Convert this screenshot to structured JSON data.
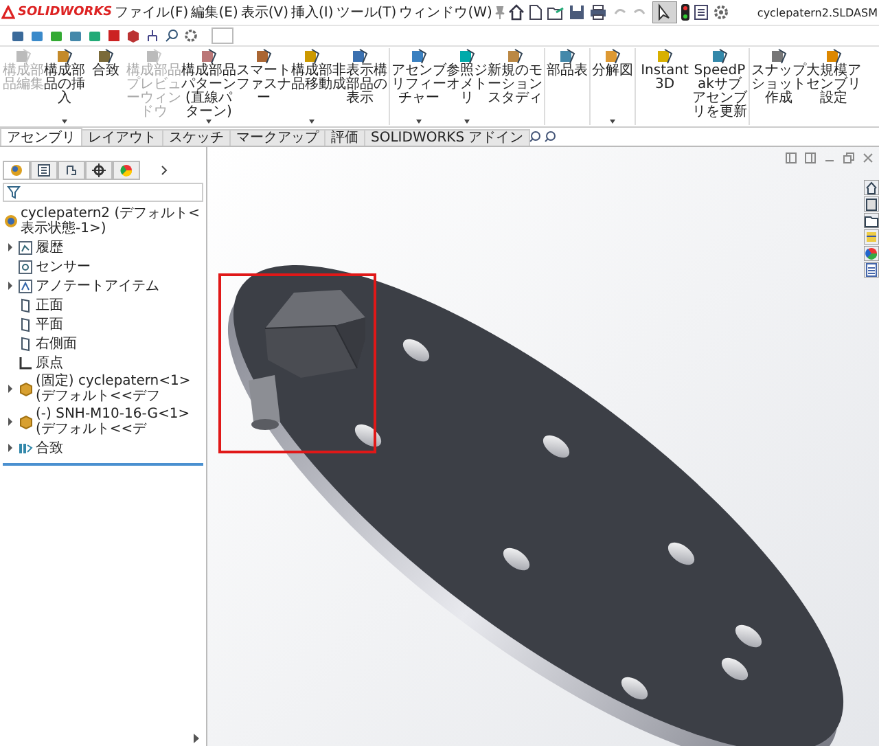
{
  "app": {
    "logo": "SOLIDWORKS",
    "menus": [
      "ファイル(F)",
      "編集(E)",
      "表示(V)",
      "挿入(I)",
      "ツール(T)",
      "ウィンドウ(W)"
    ],
    "title": "cyclepatern2.SLDASM"
  },
  "ribbon": [
    {
      "label": "構成部品編集",
      "disabled": true,
      "dropdown": false
    },
    {
      "label": "構成部品の挿入",
      "disabled": false,
      "dropdown": true
    },
    {
      "label": "合致",
      "disabled": false,
      "dropdown": false
    },
    {
      "label": "構成部品プレビューウィンドウ",
      "disabled": true,
      "dropdown": false
    },
    {
      "label": "構成部品パターン(直線パターン)",
      "disabled": false,
      "dropdown": true
    },
    {
      "label": "スマートファスナー",
      "disabled": false,
      "dropdown": false
    },
    {
      "label": "構成部品移動",
      "disabled": false,
      "dropdown": true
    },
    {
      "label": "非表示構成部品の表示",
      "disabled": false,
      "dropdown": false
    },
    {
      "label": "アセンブリフィーチャー",
      "disabled": false,
      "dropdown": true
    },
    {
      "label": "参照ジオメトリ",
      "disabled": false,
      "dropdown": true
    },
    {
      "label": "新規のモーションスタディ",
      "disabled": false,
      "dropdown": false
    },
    {
      "label": "部品表",
      "disabled": false,
      "dropdown": false
    },
    {
      "label": "分解図",
      "disabled": false,
      "dropdown": true
    },
    {
      "label": "Instant3D",
      "disabled": false,
      "dropdown": false
    },
    {
      "label": "SpeedPakサブアセンブリを更新",
      "disabled": false,
      "dropdown": false
    },
    {
      "label": "スナップショット作成",
      "disabled": false,
      "dropdown": false
    },
    {
      "label": "大規模アセンブリ設定",
      "disabled": false,
      "dropdown": false
    }
  ],
  "tabs": [
    {
      "label": "アセンブリ",
      "selected": true
    },
    {
      "label": "レイアウト",
      "selected": false
    },
    {
      "label": "スケッチ",
      "selected": false
    },
    {
      "label": "マークアップ",
      "selected": false
    },
    {
      "label": "評価",
      "selected": false
    },
    {
      "label": "SOLIDWORKS アドイン",
      "selected": false
    }
  ],
  "feature_tree": {
    "root": "cyclepatern2 (デフォルト<表示状態-1>)",
    "items": [
      {
        "label": "履歴",
        "kind": "history",
        "expandable": true
      },
      {
        "label": "センサー",
        "kind": "sensor",
        "expandable": false
      },
      {
        "label": "アノテートアイテム",
        "kind": "annotation",
        "expandable": true
      },
      {
        "label": "正面",
        "kind": "plane",
        "expandable": false
      },
      {
        "label": "平面",
        "kind": "plane",
        "expandable": false
      },
      {
        "label": "右側面",
        "kind": "plane",
        "expandable": false
      },
      {
        "label": "原点",
        "kind": "origin",
        "expandable": false
      },
      {
        "label": "(固定) cyclepatern<1> (デフォルト<<デフ",
        "kind": "component",
        "expandable": true
      },
      {
        "label": "(-) SNH-M10-16-G<1> (デフォルト<<デ",
        "kind": "component",
        "expandable": true
      },
      {
        "label": "合致",
        "kind": "mates",
        "expandable": true
      }
    ]
  }
}
